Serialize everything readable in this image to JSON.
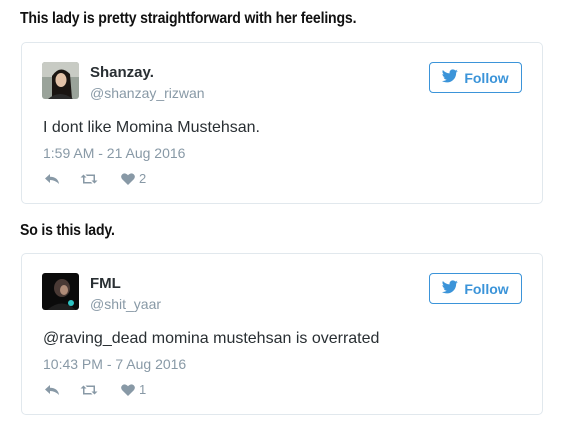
{
  "captions": {
    "first": "This lady is pretty straightforward with her feelings.",
    "second": "So is this lady."
  },
  "tweets": [
    {
      "name": "Shanzay.",
      "handle": "@shanzay_rizwan",
      "text": "I dont like Momina Mustehsan.",
      "timestamp": "1:59 AM - 21 Aug 2016",
      "likes": "2",
      "follow_label": "Follow"
    },
    {
      "name": "FML",
      "handle": "@shit_yaar",
      "text": "@raving_dead momina mustehsan is overrated",
      "timestamp": "10:43 PM - 7 Aug 2016",
      "likes": "1",
      "follow_label": "Follow"
    }
  ],
  "icons": {
    "follow": "twitter-bird-icon",
    "reply": "reply-icon",
    "retweet": "retweet-icon",
    "like": "heart-icon"
  },
  "colors": {
    "accent": "#3b94d9",
    "muted": "#8899a6",
    "text": "#292f33",
    "border": "#e1e8ed"
  }
}
